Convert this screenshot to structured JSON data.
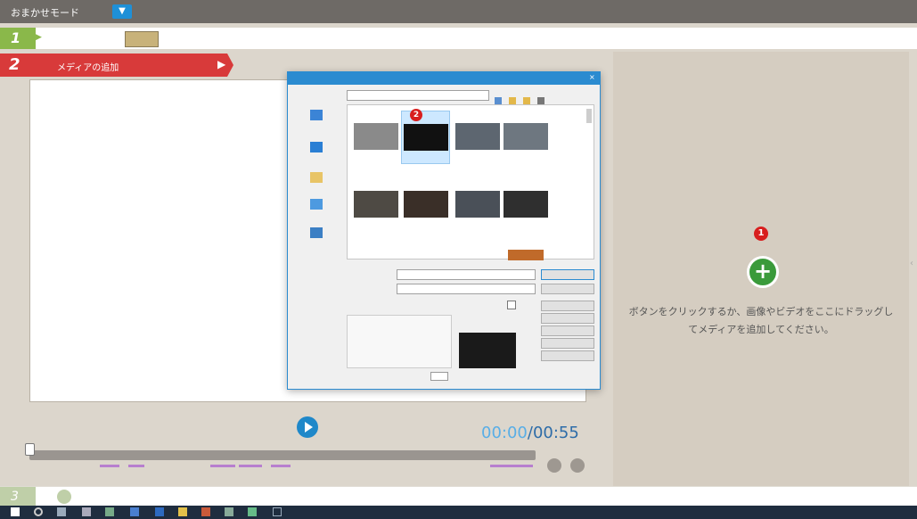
{
  "titlebar": {
    "mode": "おまかせモード",
    "dropdown_glyph": "▼",
    "center": "",
    "right": ""
  },
  "steps": {
    "step1": {
      "num": "1",
      "label": "",
      "arrow": "▶"
    },
    "step2": {
      "num": "2",
      "label": "メディアの追加",
      "arrow": "▶"
    },
    "step3": {
      "num": "3",
      "label": ""
    }
  },
  "player": {
    "time_current": "00:00",
    "time_sep": "/",
    "time_total": "00:55"
  },
  "dropzone": {
    "badge": "1",
    "add_glyph": "+",
    "hint": "ボタンをクリックするか、画像やビデオをここにドラッグしてメディアを追加してください。"
  },
  "dialog": {
    "title": "",
    "close_glyph": "×",
    "badge": "2",
    "places": [
      "",
      "",
      "",
      "",
      ""
    ],
    "files": [
      {
        "name": "",
        "selected": false
      },
      {
        "name": "",
        "selected": true
      },
      {
        "name": "",
        "selected": false
      },
      {
        "name": "",
        "selected": false
      },
      {
        "name": "",
        "selected": false
      },
      {
        "name": "",
        "selected": false
      },
      {
        "name": "",
        "selected": false
      },
      {
        "name": "",
        "selected": false
      }
    ],
    "open_button": "",
    "cancel_button": ""
  },
  "colors": {
    "accent_blue": "#1f88c9",
    "step_red": "#d83a3a",
    "step_green": "#8ab84a",
    "add_green": "#3a9a3a",
    "badge_red": "#d81e1e"
  }
}
